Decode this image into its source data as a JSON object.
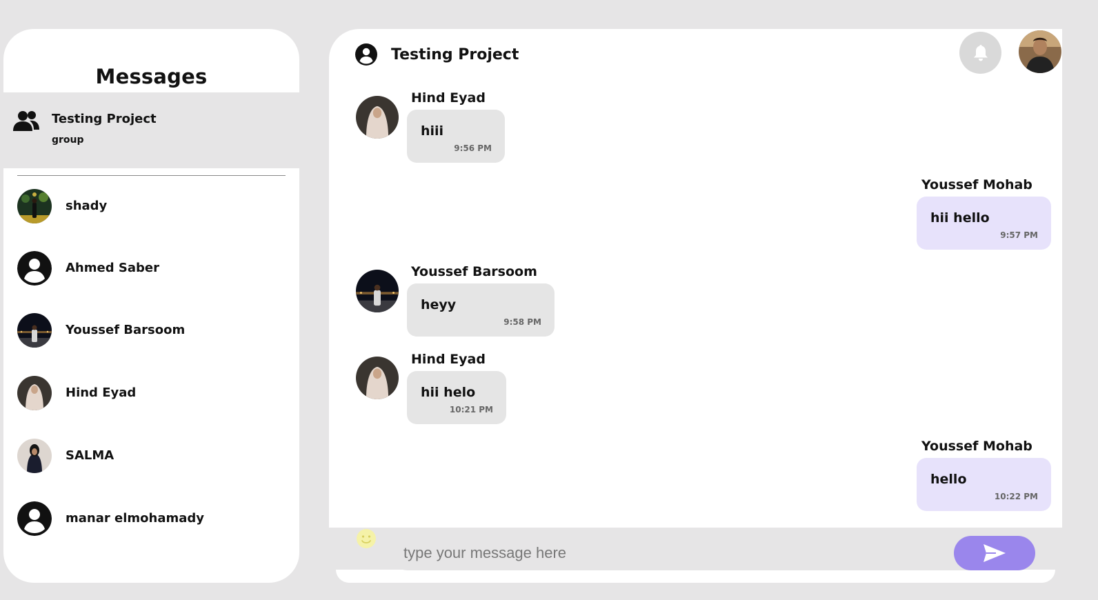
{
  "sidebar": {
    "title": "Messages",
    "group": {
      "name": "Testing Project",
      "type": "group"
    },
    "contacts": [
      {
        "name": "shady",
        "avatar": "photo-avatar"
      },
      {
        "name": "Ahmed Saber",
        "avatar": "default-user-icon"
      },
      {
        "name": "Youssef Barsoom",
        "avatar": "photo-avatar"
      },
      {
        "name": "Hind Eyad",
        "avatar": "photo-avatar"
      },
      {
        "name": "SALMA",
        "avatar": "photo-avatar"
      },
      {
        "name": "manar elmohamady",
        "avatar": "default-user-icon"
      }
    ]
  },
  "chat": {
    "title": "Testing Project",
    "messages": [
      {
        "sender": "Hind Eyad",
        "text": "hiii",
        "time": "9:56 PM",
        "mine": false
      },
      {
        "sender": "Youssef Mohab",
        "text": "hii hello",
        "time": "9:57 PM",
        "mine": true
      },
      {
        "sender": "Youssef Barsoom",
        "text": "heyy",
        "time": "9:58 PM",
        "mine": false
      },
      {
        "sender": "Hind Eyad",
        "text": "hii helo",
        "time": "10:21 PM",
        "mine": false
      },
      {
        "sender": "Youssef Mohab",
        "text": "hello",
        "time": "10:22 PM",
        "mine": true
      }
    ]
  },
  "composer": {
    "placeholder": "type your message here"
  },
  "colors": {
    "background": "#e6e5e6",
    "mine_bubble": "#e7e2fb",
    "other_bubble": "#e5e5e5",
    "send_button": "#9a86ec",
    "bell_button": "#d9d9d9"
  },
  "icons": [
    "group-icon",
    "user-circle-icon",
    "bell-icon",
    "emoji-icon",
    "send-icon"
  ]
}
